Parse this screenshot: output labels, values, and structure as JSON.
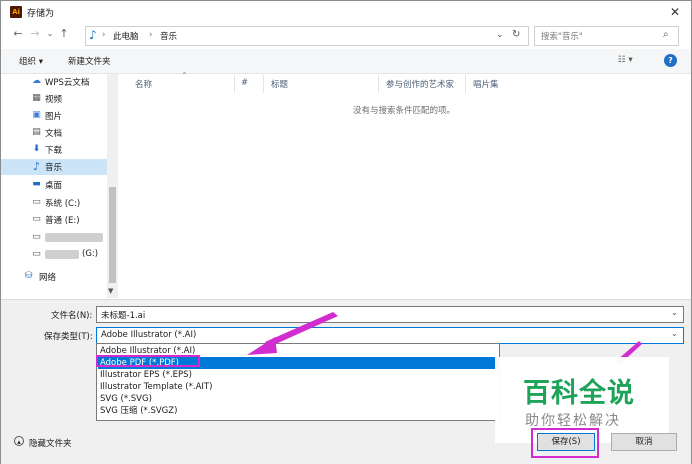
{
  "window": {
    "title": "存储为",
    "app_icon": "Ai"
  },
  "addressbar": {
    "path": [
      "此电脑",
      "音乐"
    ],
    "search_placeholder": "搜索\"音乐\""
  },
  "toolbar": {
    "organize": "组织 ▾",
    "new_folder": "新建文件夹"
  },
  "nav_items": [
    {
      "label": "WPS云文档",
      "icon": "cloud-icon"
    },
    {
      "label": "视频",
      "icon": "video-icon"
    },
    {
      "label": "图片",
      "icon": "picture-icon"
    },
    {
      "label": "文档",
      "icon": "document-icon"
    },
    {
      "label": "下载",
      "icon": "download-icon"
    },
    {
      "label": "音乐",
      "icon": "music-icon",
      "selected": true
    },
    {
      "label": "桌面",
      "icon": "desktop-icon"
    },
    {
      "label": "系统 (C:)",
      "icon": "drive-icon"
    },
    {
      "label": "普通 (E:)",
      "icon": "drive-icon"
    },
    {
      "label": "",
      "icon": "drive-icon"
    },
    {
      "label": "(G:)",
      "icon": "drive-icon"
    },
    {
      "label": "网络",
      "icon": "network-icon"
    }
  ],
  "columns": [
    "名称",
    "#",
    "标题",
    "参与创作的艺术家",
    "唱片集"
  ],
  "empty_message": "没有与搜索条件匹配的项。",
  "filename": {
    "label": "文件名(N):",
    "value": "未标题-1.ai"
  },
  "filetype": {
    "label": "保存类型(T):",
    "value": "Adobe Illustrator (*.AI)",
    "options": [
      "Adobe Illustrator (*.AI)",
      "Adobe PDF (*.PDF)",
      "Illustrator EPS (*.EPS)",
      "Illustrator Template (*.AIT)",
      "SVG (*.SVG)",
      "SVG 压缩 (*.SVGZ)"
    ],
    "highlighted_index": 1
  },
  "hide_folders": "隐藏文件夹",
  "buttons": {
    "save": "保存(S)",
    "cancel": "取消"
  },
  "watermark": {
    "title": "百科全说",
    "subtitle": "助你轻松解决"
  },
  "colors": {
    "accent": "#0078d7",
    "annotation": "#d12ccf",
    "watermark": "#1fa35a"
  }
}
